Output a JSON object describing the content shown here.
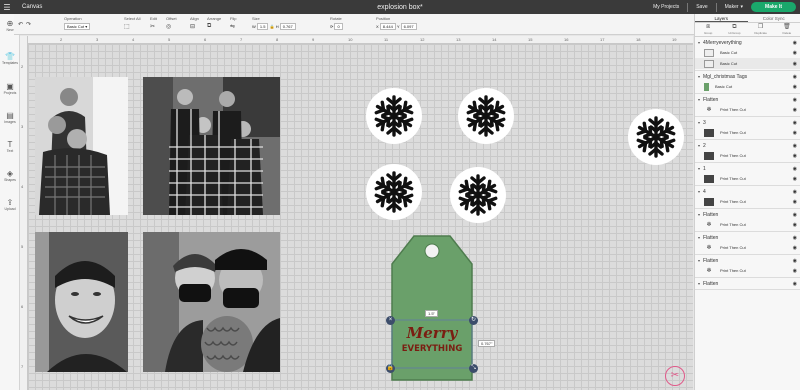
{
  "header": {
    "app_name": "Canvas",
    "project_title": "explosion box*",
    "my_projects": "My Projects",
    "save": "Save",
    "machine": "Maker",
    "make_it": "Make It"
  },
  "toolbar": {
    "operation_label": "Operation",
    "operation_value": "Basic Cut",
    "select_all_label": "Select All",
    "edit_label": "Edit",
    "offset_label": "Offset",
    "align_label": "Align",
    "arrange_label": "Arrange",
    "flip_label": "Flip",
    "size_label": "Size",
    "width_prefix": "W",
    "width_value": "1.5",
    "height_prefix": "H",
    "height_value": "0.767",
    "rotate_label": "Rotate",
    "rotate_value": "0",
    "position_label": "Position",
    "x_prefix": "X",
    "x_value": "8.444",
    "y_prefix": "Y",
    "y_value": "6.097"
  },
  "sidebar": {
    "items": [
      {
        "label": "New",
        "icon": "plus-icon"
      },
      {
        "label": "Templates",
        "icon": "shirt-icon"
      },
      {
        "label": "Projects",
        "icon": "projects-icon"
      },
      {
        "label": "Images",
        "icon": "image-icon"
      },
      {
        "label": "Text",
        "icon": "text-icon"
      },
      {
        "label": "Shapes",
        "icon": "shapes-icon"
      },
      {
        "label": "Upload",
        "icon": "upload-icon"
      }
    ]
  },
  "ruler": {
    "top": [
      "2",
      "3",
      "4",
      "5",
      "6",
      "7",
      "8",
      "9",
      "10",
      "11",
      "12",
      "13",
      "14",
      "15",
      "16",
      "17",
      "18",
      "19"
    ],
    "left": [
      "2",
      "3",
      "4",
      "5",
      "6",
      "7"
    ]
  },
  "canvas": {
    "tag_width_label": "1.5\"",
    "tag_height_label": "0.767\"",
    "tag_text_line1": "Merry",
    "tag_text_line2": "EVERYTHING",
    "colors": {
      "tag": "#6aa06a",
      "tag_text": "#7a1e12",
      "tag_outline": "#4e7c4e"
    }
  },
  "panel": {
    "tabs": [
      "Layers",
      "Color Sync"
    ],
    "actions": [
      "Group",
      "UnGroup",
      "Duplicate",
      "Delete"
    ],
    "groups": [
      {
        "name": "4Merryeverything",
        "rows": [
          {
            "label": "Basic Cut",
            "thumb": "line"
          },
          {
            "label": "Basic Cut",
            "thumb": "line",
            "selected": true
          }
        ]
      },
      {
        "name": "Mgl_christmas Tags",
        "rows": [
          {
            "label": "Basic Cut",
            "thumb": "green"
          }
        ]
      },
      {
        "name": "Flatten",
        "rows": [
          {
            "label": "Print Then Cut",
            "thumb": "snowflake"
          }
        ]
      },
      {
        "name": "3",
        "rows": [
          {
            "label": "Print Then Cut",
            "thumb": "photo"
          }
        ]
      },
      {
        "name": "2",
        "rows": [
          {
            "label": "Print Then Cut",
            "thumb": "photo"
          }
        ]
      },
      {
        "name": "1",
        "rows": [
          {
            "label": "Print Then Cut",
            "thumb": "photo"
          }
        ]
      },
      {
        "name": "4",
        "rows": [
          {
            "label": "Print Then Cut",
            "thumb": "photo"
          }
        ]
      },
      {
        "name": "Flatten",
        "rows": [
          {
            "label": "Print Then Cut",
            "thumb": "snowflake"
          }
        ]
      },
      {
        "name": "Flatten",
        "rows": [
          {
            "label": "Print Then Cut",
            "thumb": "snowflake"
          }
        ]
      },
      {
        "name": "Flatten",
        "rows": [
          {
            "label": "Print Then Cut",
            "thumb": "snowflake"
          }
        ]
      },
      {
        "name": "Flatten",
        "rows": []
      }
    ]
  }
}
